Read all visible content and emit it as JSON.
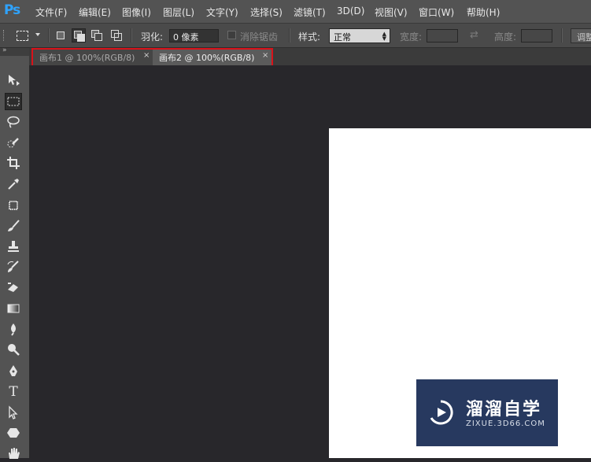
{
  "app": {
    "logo": "Ps"
  },
  "menu": [
    "文件(F)",
    "编辑(E)",
    "图像(I)",
    "图层(L)",
    "文字(Y)",
    "选择(S)",
    "滤镜(T)",
    "3D(D)",
    "视图(V)",
    "窗口(W)",
    "帮助(H)"
  ],
  "options": {
    "feather_label": "羽化:",
    "feather_value": "0 像素",
    "antialias_label": "消除锯齿",
    "style_label": "样式:",
    "style_value": "正常",
    "width_label": "宽度:",
    "height_label": "高度:",
    "adjust_label": "调整"
  },
  "tabs": [
    {
      "label": "画布1 @ 100%(RGB/8)",
      "close": "×"
    },
    {
      "label": "画布2 @ 100%(RGB/8)",
      "close": "×"
    }
  ],
  "toolbox": {
    "collapse": "»",
    "type_tool_glyph": "T"
  },
  "watermark": {
    "title": "溜溜自学",
    "subtitle": "ZIXUE.3D66.COM"
  },
  "colors": {
    "highlight": "#d9121a",
    "ps_blue": "#2fa3ff",
    "watermark_bg": "#27395f"
  }
}
